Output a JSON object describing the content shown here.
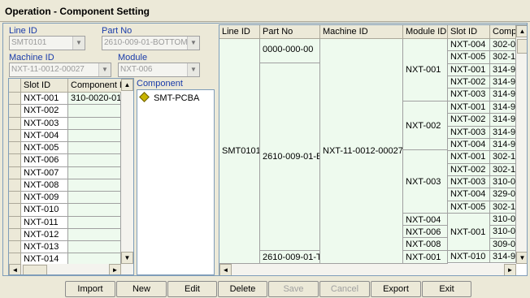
{
  "window": {
    "title": "Operation - Component Setting"
  },
  "filters": {
    "line_id_label": "Line ID",
    "line_id_value": "SMT0101",
    "part_no_label": "Part No",
    "part_no_value": "2610-009-01-BOTTOM",
    "machine_id_label": "Machine ID",
    "machine_id_value": "NXT-11-0012-00027",
    "module_label": "Module",
    "module_value": "NXT-006"
  },
  "slot_grid": {
    "headers": [
      "Slot ID",
      "Component ID"
    ],
    "rows": [
      {
        "slot": "NXT-001",
        "component": "310-0020-01"
      },
      {
        "slot": "NXT-002",
        "component": ""
      },
      {
        "slot": "NXT-003",
        "component": ""
      },
      {
        "slot": "NXT-004",
        "component": ""
      },
      {
        "slot": "NXT-005",
        "component": ""
      },
      {
        "slot": "NXT-006",
        "component": ""
      },
      {
        "slot": "NXT-007",
        "component": ""
      },
      {
        "slot": "NXT-008",
        "component": ""
      },
      {
        "slot": "NXT-009",
        "component": ""
      },
      {
        "slot": "NXT-010",
        "component": ""
      },
      {
        "slot": "NXT-011",
        "component": ""
      },
      {
        "slot": "NXT-012",
        "component": ""
      },
      {
        "slot": "NXT-013",
        "component": ""
      },
      {
        "slot": "NXT-014",
        "component": ""
      }
    ]
  },
  "component_tree": {
    "label": "Component",
    "items": [
      {
        "name": "SMT-PCBA",
        "icon": "diamond-icon"
      }
    ]
  },
  "main_grid": {
    "headers": [
      "Line ID",
      "Part No",
      "Machine ID",
      "Module ID",
      "Slot ID",
      "Compo"
    ],
    "line_id": "SMT0101",
    "part_nos": [
      "0000-000-00",
      "2610-009-01-B",
      "2610-009-01-T"
    ],
    "machine_id": "NXT-11-0012-00027",
    "modules": [
      "NXT-001",
      "NXT-002",
      "NXT-003",
      "NXT-004",
      "NXT-006",
      "NXT-008",
      "NXT-001"
    ],
    "slots": [
      {
        "slot": "NXT-004",
        "comp": "302-00"
      },
      {
        "slot": "NXT-005",
        "comp": "302-1"
      },
      {
        "slot": "NXT-001",
        "comp": "314-9"
      },
      {
        "slot": "NXT-002",
        "comp": "314-9"
      },
      {
        "slot": "NXT-003",
        "comp": "314-9"
      },
      {
        "slot": "NXT-001",
        "comp": "314-9"
      },
      {
        "slot": "NXT-002",
        "comp": "314-9"
      },
      {
        "slot": "NXT-003",
        "comp": "314-9"
      },
      {
        "slot": "NXT-004",
        "comp": "314-9"
      },
      {
        "slot": "NXT-001",
        "comp": "302-1"
      },
      {
        "slot": "NXT-002",
        "comp": "302-1"
      },
      {
        "slot": "NXT-003",
        "comp": "310-0"
      },
      {
        "slot": "NXT-004",
        "comp": "329-0"
      },
      {
        "slot": "NXT-005",
        "comp": "302-1"
      },
      {
        "slot": "",
        "comp": "310-0"
      },
      {
        "slot": "",
        "comp": "310-0"
      },
      {
        "slot": "",
        "comp": "309-0"
      },
      {
        "slot": "NXT-010",
        "comp": "314-9"
      }
    ],
    "module_span_label": "NXT-001"
  },
  "buttons": {
    "import": "Import",
    "new": "New",
    "edit": "Edit",
    "delete": "Delete",
    "save": "Save",
    "cancel": "Cancel",
    "export": "Export",
    "exit": "Exit"
  }
}
